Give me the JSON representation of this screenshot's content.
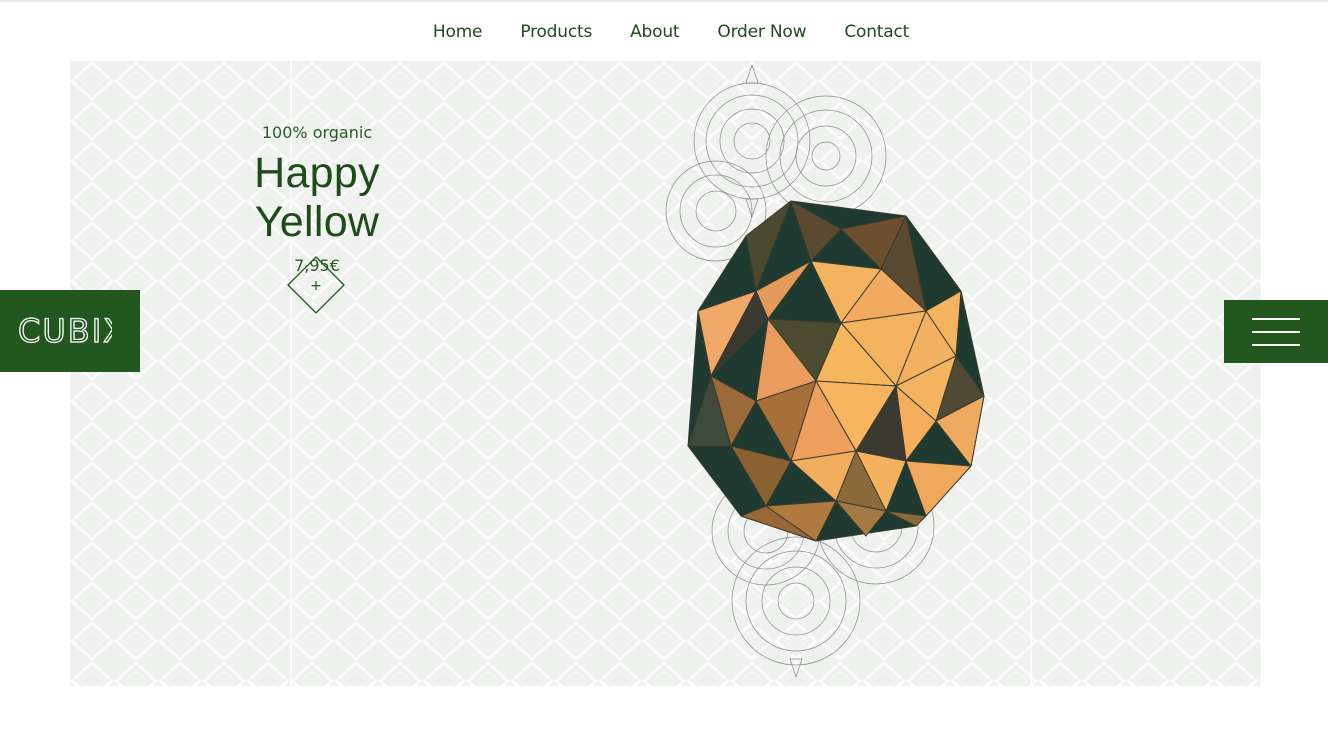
{
  "nav": {
    "items": [
      {
        "label": "Home"
      },
      {
        "label": "Products"
      },
      {
        "label": "About"
      },
      {
        "label": "Order Now"
      },
      {
        "label": "Contact"
      }
    ]
  },
  "product": {
    "tagline": "100% organic",
    "name": "Happy Yellow",
    "price": "7,95€",
    "add_symbol": "+"
  },
  "brand": {
    "logo_text": "CUBIX",
    "color": "#225720"
  },
  "colors": {
    "hero_background": "#eef1ee",
    "text_green": "#1f4a1b",
    "polyhedron_light": "#f4b35e",
    "polyhedron_dark": "#1f3a30"
  },
  "icons": {
    "menu": "hamburger-icon",
    "add": "plus-icon"
  }
}
